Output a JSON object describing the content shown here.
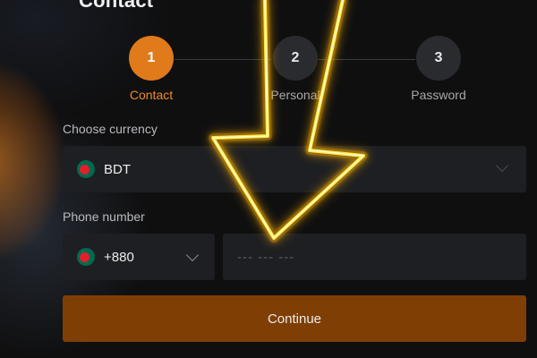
{
  "page": {
    "title": "Contact"
  },
  "stepper": {
    "steps": [
      {
        "number": "1",
        "label": "Contact"
      },
      {
        "number": "2",
        "label": "Personal"
      },
      {
        "number": "3",
        "label": "Password"
      }
    ],
    "active_step": 1
  },
  "form": {
    "currency": {
      "label": "Choose currency",
      "value": "BDT",
      "flag_icon": "bangladesh-flag-icon"
    },
    "phone": {
      "label": "Phone number",
      "country_code": "+880",
      "flag_icon": "bangladesh-flag-icon",
      "placeholder": "--- --- ---",
      "value": ""
    },
    "continue_label": "Continue"
  },
  "colors": {
    "accent": "#e07a1a",
    "button": "#7f3f04",
    "field_bg": "#1e1f22",
    "page_bg": "#0f0f10",
    "arrow_glow": "#ffd400"
  }
}
